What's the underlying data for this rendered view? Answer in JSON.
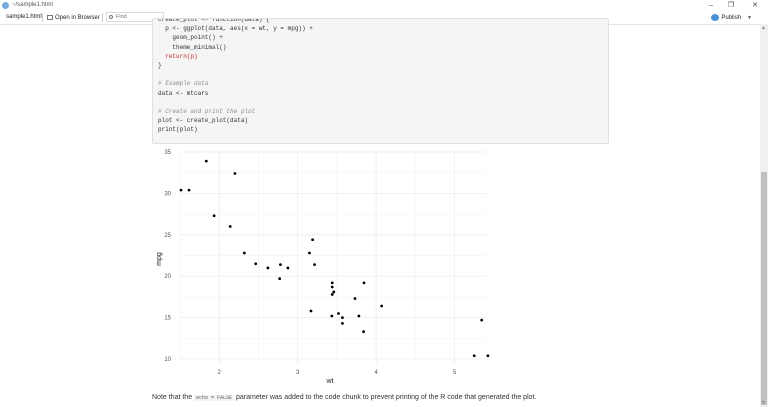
{
  "window": {
    "title": "~/sample1.html",
    "minimize_glyph": "–",
    "maximize_glyph": "❐",
    "close_glyph": "✕"
  },
  "toolbar": {
    "file_name": "sample1.html",
    "open_in_browser": "Open in Browser",
    "find_placeholder": "Find",
    "publish": "Publish"
  },
  "code": {
    "lines": [
      {
        "text": "create_plot <- function(data) {",
        "style": "normal"
      },
      {
        "text": "  p <- ggplot(data, aes(x = wt, y = mpg)) +",
        "style": "normal"
      },
      {
        "text": "    geom_point() +",
        "style": "normal"
      },
      {
        "text": "    theme_minimal()",
        "style": "normal"
      },
      {
        "text": "  return(p)",
        "style": "return"
      },
      {
        "text": "}",
        "style": "normal"
      },
      {
        "text": "",
        "style": "normal"
      },
      {
        "text": "# Example data",
        "style": "comment"
      },
      {
        "text": "data <- mtcars",
        "style": "normal"
      },
      {
        "text": "",
        "style": "normal"
      },
      {
        "text": "# Create and print the plot",
        "style": "comment"
      },
      {
        "text": "plot <- create_plot(data)",
        "style": "normal"
      },
      {
        "text": "print(plot)",
        "style": "normal"
      }
    ]
  },
  "chart_data": {
    "type": "scatter",
    "xlabel": "wt",
    "ylabel": "mpg",
    "xlim": [
      1.5,
      5.4
    ],
    "ylim": [
      9.4,
      35
    ],
    "xticks": [
      2,
      3,
      4,
      5
    ],
    "yticks": [
      10,
      15,
      20,
      25,
      30,
      35
    ],
    "grid": true,
    "point_color": "#000000",
    "points": [
      [
        2.62,
        21.0
      ],
      [
        2.875,
        21.0
      ],
      [
        2.32,
        22.8
      ],
      [
        3.215,
        21.4
      ],
      [
        3.44,
        18.7
      ],
      [
        3.46,
        18.1
      ],
      [
        3.57,
        14.3
      ],
      [
        3.19,
        24.4
      ],
      [
        3.15,
        22.8
      ],
      [
        3.44,
        19.2
      ],
      [
        3.44,
        17.8
      ],
      [
        4.07,
        16.4
      ],
      [
        3.73,
        17.3
      ],
      [
        3.78,
        15.2
      ],
      [
        5.25,
        10.4
      ],
      [
        5.424,
        10.4
      ],
      [
        5.345,
        14.7
      ],
      [
        2.2,
        32.4
      ],
      [
        1.615,
        30.4
      ],
      [
        1.835,
        33.9
      ],
      [
        2.465,
        21.5
      ],
      [
        3.52,
        15.5
      ],
      [
        3.435,
        15.2
      ],
      [
        3.84,
        13.3
      ],
      [
        3.845,
        19.2
      ],
      [
        1.935,
        27.3
      ],
      [
        2.14,
        26.0
      ],
      [
        1.513,
        30.4
      ],
      [
        3.17,
        15.8
      ],
      [
        2.77,
        19.7
      ],
      [
        3.57,
        15.0
      ],
      [
        2.78,
        21.4
      ]
    ]
  },
  "footnote": {
    "before": "Note that the ",
    "code": "echo = FALSE",
    "after": " parameter was added to the code chunk to prevent printing of the R code that generated the plot."
  }
}
